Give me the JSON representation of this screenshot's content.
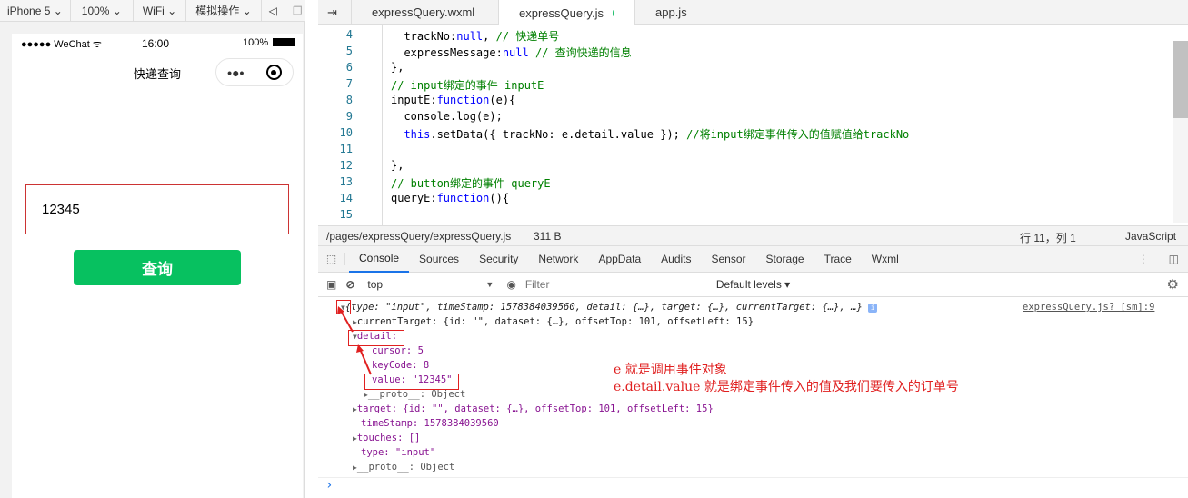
{
  "simulator": {
    "toolbar": {
      "device": "iPhone 5 ⌄",
      "zoom": "100% ⌄",
      "network": "WiFi ⌄",
      "ops": "模拟操作 ⌄"
    },
    "status": {
      "carrier": "●●●●● WeChat",
      "time": "16:00",
      "battery": "100%"
    },
    "nav_title": "快递查询",
    "input_value": "12345",
    "button_label": "查询"
  },
  "editor": {
    "tabs": [
      {
        "label": "expressQuery.wxml"
      },
      {
        "label": "expressQuery.js",
        "modified": true
      },
      {
        "label": "app.js"
      }
    ],
    "lines": [
      {
        "n": "4",
        "seg": [
          [
            "  trackNo:",
            ""
          ],
          [
            "null",
            ""
          ],
          [
            ", ",
            ""
          ],
          [
            "// 快递单号",
            "cm"
          ]
        ]
      },
      {
        "n": "5",
        "seg": [
          [
            "  expressMessage:",
            ""
          ],
          [
            "null",
            "kw"
          ],
          [
            " ",
            ""
          ],
          [
            "// 查询快递的信息",
            "cm"
          ]
        ]
      },
      {
        "n": "6",
        "seg": [
          [
            "},",
            ""
          ]
        ]
      },
      {
        "n": "7",
        "seg": [
          [
            "// input绑定的事件 inputE",
            "cm"
          ]
        ]
      },
      {
        "n": "8",
        "seg": [
          [
            "inputE:",
            ""
          ],
          [
            "function",
            "kw"
          ],
          [
            "(e){",
            ""
          ]
        ]
      },
      {
        "n": "9",
        "seg": [
          [
            "  console.log(e);",
            ""
          ]
        ]
      },
      {
        "n": "10",
        "seg": [
          [
            "  ",
            ""
          ],
          [
            "this",
            "kw"
          ],
          [
            ".setData({ trackNo: e.detail.value }); ",
            ""
          ],
          [
            "//将input绑定事件传入的值赋值给trackNo",
            "cm"
          ]
        ]
      },
      {
        "n": "11",
        "seg": []
      },
      {
        "n": "12",
        "seg": [
          [
            "},",
            ""
          ]
        ]
      },
      {
        "n": "13",
        "seg": [
          [
            "// button绑定的事件 queryE",
            "cm"
          ]
        ]
      },
      {
        "n": "14",
        "seg": [
          [
            "queryE:",
            ""
          ],
          [
            "function",
            "kw"
          ],
          [
            "(){",
            ""
          ]
        ]
      },
      {
        "n": "15",
        "seg": []
      }
    ],
    "status": {
      "path": "/pages/expressQuery/expressQuery.js",
      "size": "311 B",
      "position": "行 11，列 1",
      "language": "JavaScript"
    }
  },
  "devtools": {
    "tabs": [
      "Console",
      "Sources",
      "Security",
      "Network",
      "AppData",
      "Audits",
      "Sensor",
      "Storage",
      "Trace",
      "Wxml"
    ],
    "active_tab": "Console",
    "context": "top",
    "filter_placeholder": "Filter",
    "levels": "Default levels ▾",
    "source_link": "expressQuery.js? [sm]:9",
    "log": [
      "{type: \"input\", timeStamp: 1578384039560, detail: {…}, target: {…}, currentTarget: {…}, …}",
      "currentTarget: {id: \"\", dataset: {…}, offsetTop: 101, offsetLeft: 15}",
      "detail:",
      "cursor: 5",
      "keyCode: 8",
      "value: \"12345\"",
      "__proto__: Object",
      "target: {id: \"\", dataset: {…}, offsetTop: 101, offsetLeft: 15}",
      "timeStamp: 1578384039560",
      "touches: []",
      "type: \"input\"",
      "__proto__: Object"
    ],
    "prompt": "›"
  },
  "annotations": [
    "e 就是调用事件对象",
    "e.detail.value 就是绑定事件传入的值及我们要传入的订单号"
  ],
  "colors": {
    "accent_green": "#07c160",
    "annotation_red": "#e02020",
    "tab_active": "#1a73e8"
  }
}
